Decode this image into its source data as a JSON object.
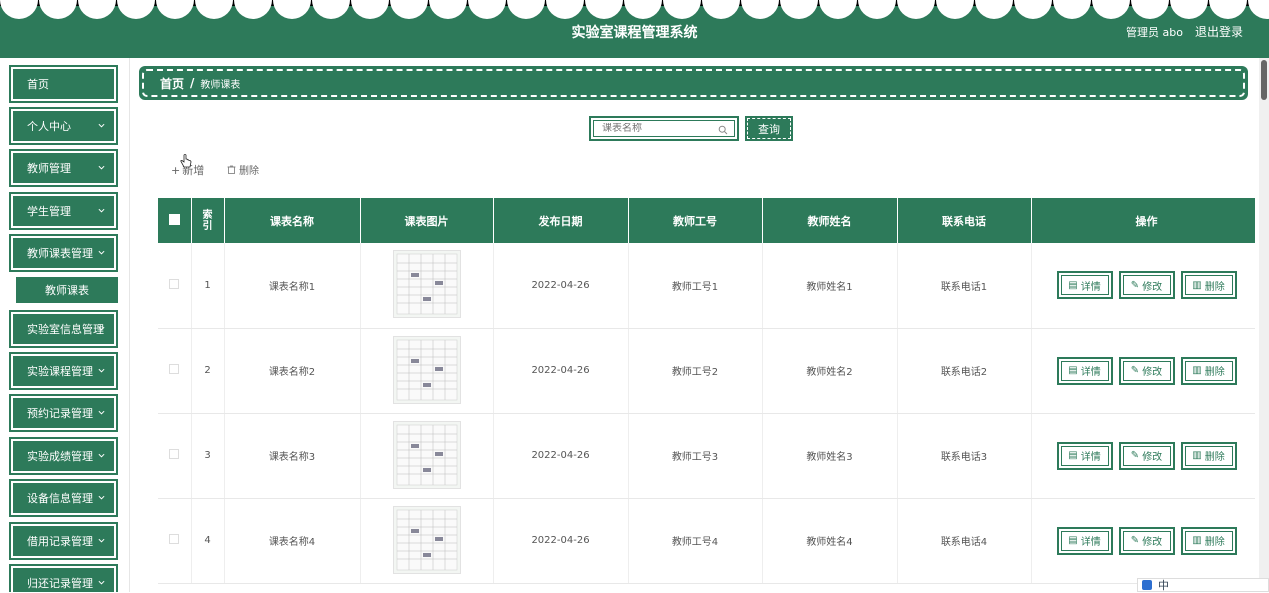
{
  "header": {
    "title": "实验室课程管理系统",
    "user": "管理员 abo",
    "logout": "退出登录"
  },
  "sidebar": {
    "items": [
      {
        "label": "首页",
        "has_chevron": false
      },
      {
        "label": "个人中心",
        "has_chevron": true
      },
      {
        "label": "教师管理",
        "has_chevron": true
      },
      {
        "label": "学生管理",
        "has_chevron": true
      },
      {
        "label": "教师课表管理",
        "has_chevron": true
      },
      {
        "label": "实验室信息管理",
        "has_chevron": true
      },
      {
        "label": "实验课程管理",
        "has_chevron": true
      },
      {
        "label": "预约记录管理",
        "has_chevron": true
      },
      {
        "label": "实验成绩管理",
        "has_chevron": true
      },
      {
        "label": "设备信息管理",
        "has_chevron": true
      },
      {
        "label": "借用记录管理",
        "has_chevron": true
      },
      {
        "label": "归还记录管理",
        "has_chevron": true
      }
    ],
    "sub_item": "教师课表"
  },
  "breadcrumb": {
    "home": "首页",
    "separator": "/",
    "current": "教师课表"
  },
  "search": {
    "placeholder": "课表名称",
    "button": "查询"
  },
  "actions": {
    "add": "新增",
    "delete": "删除"
  },
  "table": {
    "headers": [
      "",
      "索引",
      "课表名称",
      "课表图片",
      "发布日期",
      "教师工号",
      "教师姓名",
      "联系电话",
      "操作"
    ],
    "rows": [
      {
        "index": "1",
        "name": "课表名称1",
        "date": "2022-04-26",
        "teacher_id": "教师工号1",
        "teacher_name": "教师姓名1",
        "phone": "联系电话1"
      },
      {
        "index": "2",
        "name": "课表名称2",
        "date": "2022-04-26",
        "teacher_id": "教师工号2",
        "teacher_name": "教师姓名2",
        "phone": "联系电话2"
      },
      {
        "index": "3",
        "name": "课表名称3",
        "date": "2022-04-26",
        "teacher_id": "教师工号3",
        "teacher_name": "教师姓名3",
        "phone": "联系电话3"
      },
      {
        "index": "4",
        "name": "课表名称4",
        "date": "2022-04-26",
        "teacher_id": "教师工号4",
        "teacher_name": "教师姓名4",
        "phone": "联系电话4"
      }
    ],
    "row_actions": {
      "detail": "详情",
      "edit": "修改",
      "delete": "删除"
    }
  },
  "ime": {
    "label": "中"
  },
  "colors": {
    "primary": "#2d7a5a",
    "header_bg": "#2d7a5a"
  }
}
